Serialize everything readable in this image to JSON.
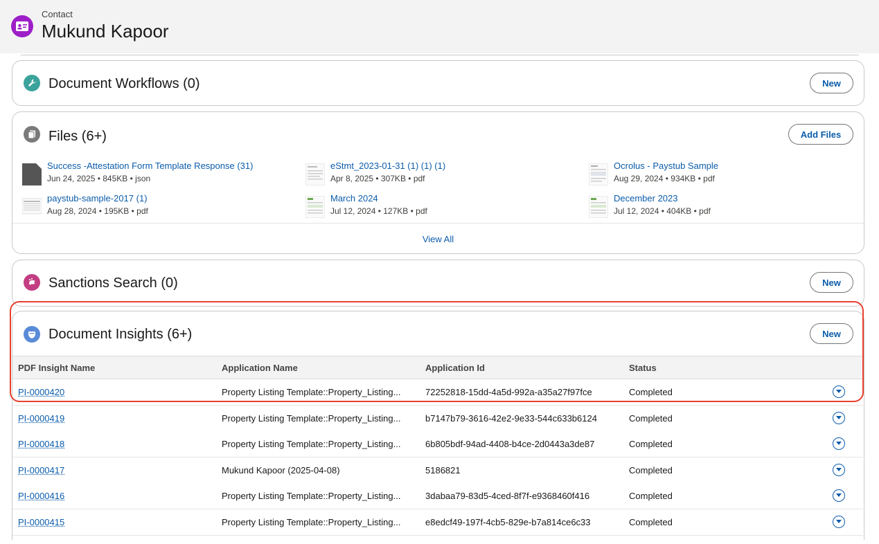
{
  "header": {
    "object_type": "Contact",
    "record_name": "Mukund Kapoor"
  },
  "colors": {
    "brand_blue": "#0b5cab",
    "contact_icon": "#9d1fc7",
    "highlight": "#e8402f"
  },
  "document_workflows": {
    "title": "Document Workflows (0)",
    "button": "New",
    "icon": "wrench-icon"
  },
  "files": {
    "title": "Files (6+)",
    "button": "Add Files",
    "view_all": "View All",
    "icon": "files-icon",
    "items": [
      {
        "name": "Success -Attestation Form Template Response (31)",
        "meta": "Jun 24, 2025  •  845KB  •  json",
        "thumb": "generic-doc"
      },
      {
        "name": "eStmt_2023-01-31 (1) (1) (1)",
        "meta": "Apr 8, 2025  •  307KB  •  pdf",
        "thumb": "pdf-page"
      },
      {
        "name": "Ocrolus - Paystub Sample",
        "meta": "Aug 29, 2024  •  934KB  •  pdf",
        "thumb": "pdf-page"
      },
      {
        "name": "paystub-sample-2017 (1)",
        "meta": "Aug 28, 2024  •  195KB  •  pdf",
        "thumb": "pdf-table"
      },
      {
        "name": "March 2024",
        "meta": "Jul 12, 2024  •  127KB  •  pdf",
        "thumb": "pdf-statement"
      },
      {
        "name": "December 2023",
        "meta": "Jul 12, 2024  •  404KB  •  pdf",
        "thumb": "pdf-statement"
      }
    ]
  },
  "sanctions_search": {
    "title": "Sanctions Search (0)",
    "button": "New",
    "icon": "hand-icon"
  },
  "document_insights": {
    "title": "Document Insights (6+)",
    "button": "New",
    "icon": "insight-shield-icon",
    "columns": [
      "PDF Insight Name",
      "Application Name",
      "Application Id",
      "Status"
    ],
    "rows": [
      {
        "name": "PI-0000420",
        "app_name": "Property Listing Template::Property_Listing...",
        "app_id": "72252818-15dd-4a5d-992a-a35a27f97fce",
        "status": "Completed"
      },
      {
        "name": "PI-0000419",
        "app_name": "Property Listing Template::Property_Listing...",
        "app_id": "b7147b79-3616-42e2-9e33-544c633b6124",
        "status": "Completed"
      },
      {
        "name": "PI-0000418",
        "app_name": "Property Listing Template::Property_Listing...",
        "app_id": "6b805bdf-94ad-4408-b4ce-2d0443a3de87",
        "status": "Completed"
      },
      {
        "name": "PI-0000417",
        "app_name": "Mukund Kapoor (2025-04-08)",
        "app_id": "5186821",
        "status": "Completed"
      },
      {
        "name": "PI-0000416",
        "app_name": "Property Listing Template::Property_Listing...",
        "app_id": "3dabaa79-83d5-4ced-8f7f-e9368460f416",
        "status": "Completed"
      },
      {
        "name": "PI-0000415",
        "app_name": "Property Listing Template::Property_Listing...",
        "app_id": "e8edcf49-197f-4cb5-829e-b7a814ce6c33",
        "status": "Completed"
      }
    ]
  }
}
